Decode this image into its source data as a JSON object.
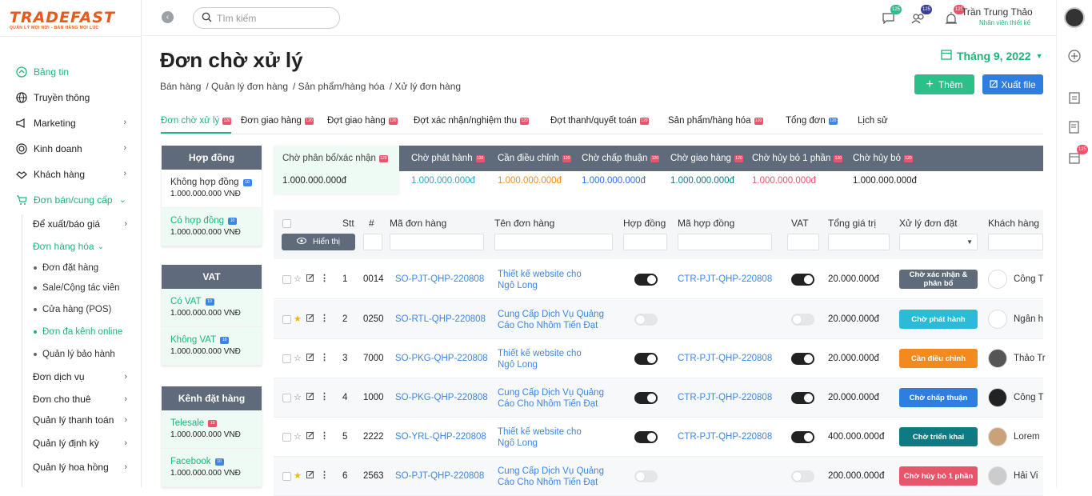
{
  "brand": {
    "name": "TRADEFAST",
    "tagline": "QUẢN LÝ MỌI NƠI - BÁN HÀNG MỌI LÚC"
  },
  "sidebar": {
    "items": [
      {
        "label": "Bảng tin",
        "icon": "dashboard-icon"
      },
      {
        "label": "Truyền thông",
        "icon": "globe-icon"
      },
      {
        "label": "Marketing",
        "icon": "megaphone-icon"
      },
      {
        "label": "Kinh doanh",
        "icon": "target-icon"
      },
      {
        "label": "Khách hàng",
        "icon": "handshake-icon"
      },
      {
        "label": "Đơn bán/cung cấp",
        "icon": "cart-icon"
      }
    ],
    "sub": [
      {
        "label": "Để xuất/báo giá"
      },
      {
        "label": "Đơn hàng hóa"
      },
      {
        "label": "Đơn dịch vụ"
      },
      {
        "label": "Đơn cho thuê"
      },
      {
        "label": "Quản lý thanh toán"
      },
      {
        "label": "Quản lý định kỳ"
      },
      {
        "label": "Quản lý hoa hồng"
      }
    ],
    "subsub": [
      {
        "label": "Đơn đặt hàng"
      },
      {
        "label": "Sale/Cộng tác viên"
      },
      {
        "label": "Cửa hàng (POS)"
      },
      {
        "label": "Đơn đa kênh online"
      },
      {
        "label": "Quản lý bảo hành"
      }
    ]
  },
  "topbar": {
    "search_placeholder": "Tìm kiếm",
    "badges": [
      "125",
      "125",
      "125"
    ],
    "user_name": "Trần Trung Thảo",
    "user_role": "Nhân viên thiết kế"
  },
  "rail": {
    "badge": "125"
  },
  "page": {
    "title": "Đơn chờ xử lý",
    "breadcrumbs": [
      "Bán hàng",
      "/ Quản lý đơn hàng",
      "/ Sản phẩm/hàng hóa",
      "/ Xử lý đơn hàng"
    ],
    "month": "Tháng 9, 2022",
    "add_label": "Thêm",
    "export_label": "Xuất file"
  },
  "tabs": [
    {
      "label": "Đơn chờ xử lý",
      "badge": "120"
    },
    {
      "label": "Đơn giao hàng",
      "badge": "120"
    },
    {
      "label": "Đợt giao hàng",
      "badge": "120"
    },
    {
      "label": "Đợt xác nhận/nghiệm thu",
      "badge": "120"
    },
    {
      "label": "Đợt thanh/quyết toán",
      "badge": "120"
    },
    {
      "label": "Sản phẩm/hàng hóa",
      "badge": "120"
    },
    {
      "label": "Tổng đơn",
      "badge": "120"
    },
    {
      "label": "Lịch sử"
    }
  ],
  "filters": {
    "contract": {
      "title": "Hợp đồng",
      "options": [
        {
          "label": "Không hợp đồng",
          "badge": "10",
          "value": "1.000.000.000 VNĐ"
        },
        {
          "label": "Có hợp đồng",
          "badge": "10",
          "value": "1.000.000.000 VNĐ"
        }
      ]
    },
    "vat": {
      "title": "VAT",
      "options": [
        {
          "label": "Có VAT",
          "badge": "10",
          "value": "1.000.000.000 VNĐ"
        },
        {
          "label": "Không VAT",
          "badge": "10",
          "value": "1.000.000.000 VNĐ"
        }
      ]
    },
    "channel": {
      "title": "Kênh đặt hàng",
      "options": [
        {
          "label": "Telesale",
          "badge": "10",
          "value": "1.000.000.000 VNĐ"
        },
        {
          "label": "Facebook",
          "badge": "10",
          "value": "1.000.000.000 VNĐ"
        }
      ]
    }
  },
  "statuses": [
    {
      "label": "Chờ phân bổ/xác nhận",
      "badge": "120",
      "value": "1.000.000.000đ",
      "color": "#222222"
    },
    {
      "label": "Chờ phát hành",
      "badge": "120",
      "value": "1.000.000.000đ",
      "color": "#2aa6c9"
    },
    {
      "label": "Cần điều chỉnh",
      "badge": "120",
      "value": "1.000.000.000đ",
      "color": "#f28a1e"
    },
    {
      "label": "Chờ chấp thuận",
      "badge": "120",
      "value": "1.000.000.000đ",
      "color": "#2e6fd6"
    },
    {
      "label": "Chờ giao hàng",
      "badge": "120",
      "value": "1.000.000.000đ",
      "color": "#0e7a84"
    },
    {
      "label": "Chờ hủy bỏ 1 phần",
      "badge": "120",
      "value": "1.000.000.000đ",
      "color": "#e8546a"
    },
    {
      "label": "Chờ hủy bỏ",
      "badge": "120",
      "value": "1.000.000.000đ",
      "color": "#222222"
    }
  ],
  "table": {
    "show_label": "Hiển thị",
    "headers": [
      "Stt",
      "#",
      "Mã đơn hàng",
      "Tên đơn hàng",
      "Hợp đồng",
      "Mã hợp đồng",
      "VAT",
      "Tổng giá trị",
      "Xử lý đơn đặt",
      "Khách hàng"
    ],
    "rows": [
      {
        "stt": "1",
        "num": "0014",
        "code": "SO-PJT-QHP-220808",
        "name1": "Thiết kế website cho",
        "name2": "Ngô Long",
        "contract": true,
        "contract_code": "CTR-PJT-QHP-220808",
        "vat": true,
        "total": "20.000.000đ",
        "status": "Chờ xác nhận & phân bổ",
        "status_color": "#5f6b7a",
        "customer": "Công T",
        "starred": false
      },
      {
        "stt": "2",
        "num": "0250",
        "code": "SO-RTL-QHP-220808",
        "name1": "Cung Cấp Dịch Vụ Quảng",
        "name2": "Cáo Cho Nhôm Tiến Đạt",
        "contract": false,
        "contract_code": "",
        "vat": false,
        "total": "20.000.000đ",
        "status": "Chờ phát hành",
        "status_color": "#2bbbd8",
        "customer": "Ngân h",
        "starred": true
      },
      {
        "stt": "3",
        "num": "7000",
        "code": "SO-PKG-QHP-220808",
        "name1": "Thiết kế website cho",
        "name2": "Ngô Long",
        "contract": true,
        "contract_code": "CTR-PJT-QHP-220808",
        "vat": true,
        "total": "20.000.000đ",
        "status": "Cần điều chỉnh",
        "status_color": "#f28a1e",
        "customer": "Thảo Tr",
        "starred": false
      },
      {
        "stt": "4",
        "num": "1000",
        "code": "SO-PKG-QHP-220808",
        "name1": "Cung Cấp Dịch Vụ Quảng",
        "name2": "Cáo Cho Nhôm Tiến Đạt",
        "contract": true,
        "contract_code": "CTR-PJT-QHP-220808",
        "vat": true,
        "total": "20.000.000đ",
        "status": "Chờ chấp thuận",
        "status_color": "#2e7de0",
        "customer": "Công T",
        "starred": false
      },
      {
        "stt": "5",
        "num": "2222",
        "code": "SO-YRL-QHP-220808",
        "name1": "Thiết kế website cho",
        "name2": "Ngô Long",
        "contract": true,
        "contract_code": "CTR-PJT-QHP-220808",
        "vat": true,
        "total": "400.000.000đ",
        "status": "Chờ triển khai",
        "status_color": "#0e7a84",
        "customer": "Lorem",
        "starred": false
      },
      {
        "stt": "6",
        "num": "2563",
        "code": "SO-PJT-QHP-220808",
        "name1": "Cung Cấp Dịch Vụ Quảng",
        "name2": "Cáo Cho Nhôm Tiến Đạt",
        "contract": false,
        "contract_code": "",
        "vat": false,
        "total": "200.000.000đ",
        "status": "Chờ hủy bỏ 1 phần",
        "status_color": "#e8546a",
        "customer": "Hải Vi",
        "starred": true
      }
    ]
  }
}
